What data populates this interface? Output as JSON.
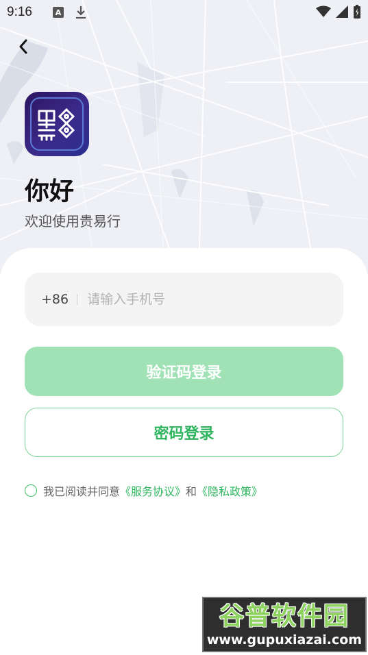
{
  "status_bar": {
    "time": "9:16",
    "notification_badge": "A"
  },
  "header": {
    "back_icon": "chevron-left-icon"
  },
  "greeting": {
    "title": "你好",
    "subtitle": "欢迎使用贵易行"
  },
  "phone_field": {
    "country_code": "+86",
    "placeholder": "请输入手机号"
  },
  "buttons": {
    "code_login": "验证码登录",
    "password_login": "密码登录"
  },
  "agreement": {
    "prefix": "我已阅读并同意",
    "service_link": "《服务协议》",
    "conjunction": "和",
    "privacy_link": "《隐私政策》"
  },
  "watermark": {
    "title": "谷普软件园",
    "url": "www.gupuxiazai.com"
  },
  "colors": {
    "primary_green": "#2fb55f",
    "disabled_green": "#a0e2b5",
    "logo_purple": "#2b1560"
  }
}
